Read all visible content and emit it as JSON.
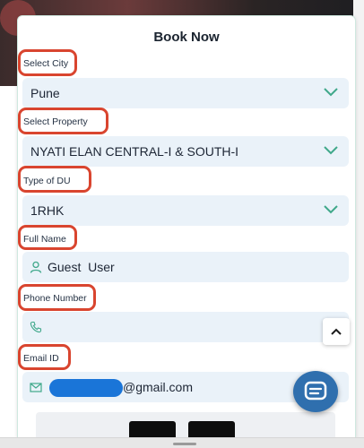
{
  "modal": {
    "title": "Book Now"
  },
  "form": {
    "city": {
      "label": "Select City",
      "value": "Pune"
    },
    "property": {
      "label": "Select Property",
      "value": "NYATI ELAN CENTRAL-I & SOUTH-I"
    },
    "du_type": {
      "label": "Type of DU",
      "value": "1RHK"
    },
    "full_name": {
      "label": "Full Name",
      "value": "Guest  User"
    },
    "phone": {
      "label": "Phone Number",
      "value": ""
    },
    "email": {
      "label": "Email ID",
      "value_suffix": "@gmail.com"
    }
  },
  "colors": {
    "accent": "#3fa88a",
    "field_bg": "#eaf2f9",
    "annotation_ring": "#d9452f",
    "chat_button": "#2f6fae",
    "email_mask": "#1a75d8"
  },
  "icons": {
    "dropdown": "chevron-down-icon",
    "name": "user-icon",
    "phone": "phone-icon",
    "email": "mail-icon",
    "scroll_top": "chevron-up-icon",
    "chat": "chat-icon"
  }
}
